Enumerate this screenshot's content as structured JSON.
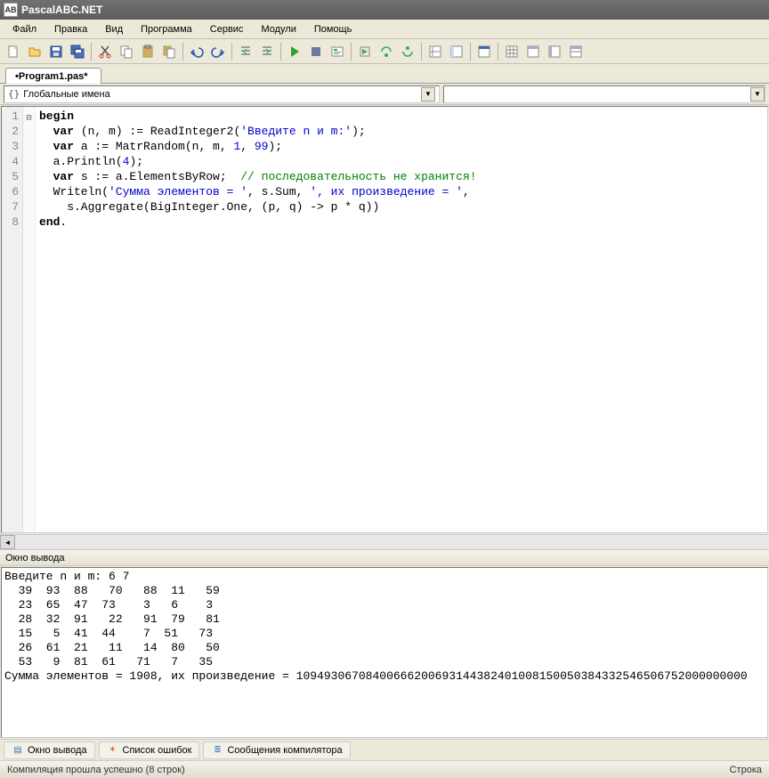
{
  "app": {
    "title": "PascalABC.NET",
    "logo_text": "AB"
  },
  "menu": {
    "items": [
      "Файл",
      "Правка",
      "Вид",
      "Программа",
      "Сервис",
      "Модули",
      "Помощь"
    ]
  },
  "toolbar_icons": [
    "new-file",
    "open-file",
    "save",
    "save-all",
    "|",
    "cut",
    "copy",
    "paste",
    "multi-paste",
    "|",
    "undo",
    "redo",
    "|",
    "indent-left",
    "indent-right",
    "|",
    "run",
    "stop",
    "step",
    "|",
    "into",
    "over",
    "out",
    "|",
    "toggle-a",
    "toggle-b",
    "|",
    "window",
    "|",
    "grid",
    "tbl-a",
    "tbl-b",
    "tbl-c"
  ],
  "tab": {
    "label": "•Program1.pas*"
  },
  "dropdown": {
    "label": "Глобальные имена",
    "marker": "{}"
  },
  "code": {
    "lines": [
      {
        "n": "1",
        "fold": "⊟",
        "html": "<span class='kw'>begin</span>"
      },
      {
        "n": "2",
        "fold": "",
        "html": "  <span class='kw'>var</span> (n, m) := ReadInteger2(<span class='str'>'Введите n и m:'</span>);"
      },
      {
        "n": "3",
        "fold": "",
        "html": "  <span class='kw'>var</span> a := MatrRandom(n, m, <span class='num'>1</span>, <span class='num'>99</span>);"
      },
      {
        "n": "4",
        "fold": "",
        "html": "  a.Println(<span class='num'>4</span>);"
      },
      {
        "n": "5",
        "fold": "",
        "html": "  <span class='kw'>var</span> s := a.ElementsByRow;  <span class='cmt'>// последовательность не хранится!</span>"
      },
      {
        "n": "6",
        "fold": "",
        "html": "  Writeln(<span class='str'>'Сумма элементов = '</span>, s.Sum, <span class='str'>', их произведение = '</span>,"
      },
      {
        "n": "7",
        "fold": "",
        "html": "    s.Aggregate(BigInteger.One, (p, q) -> p * q))"
      },
      {
        "n": "8",
        "fold": "",
        "html": "<span class='kw'>end</span>."
      }
    ]
  },
  "output": {
    "title": "Окно вывода",
    "text": "Введите n и m: 6 7\n  39  93  88   70   88  11   59\n  23  65  47  73    3   6    3\n  28  32  91   22   91  79   81\n  15   5  41  44    7  51   73\n  26  61  21   11   14  80   50\n  53   9  81  61   71   7   35\nСумма элементов = 1908, их произведение = 10949306708400666200693144382401008150050384332546506752000000000"
  },
  "bottom_tabs": [
    {
      "icon": "▤",
      "label": "Окно вывода",
      "color": "#3a7abd"
    },
    {
      "icon": "✶",
      "label": "Список ошибок",
      "color": "#d06a2e"
    },
    {
      "icon": "≣",
      "label": "Сообщения компилятора",
      "color": "#3a7abd"
    }
  ],
  "status": {
    "left": "Компиляция прошла успешно (8 строк)",
    "right": "Строка"
  }
}
